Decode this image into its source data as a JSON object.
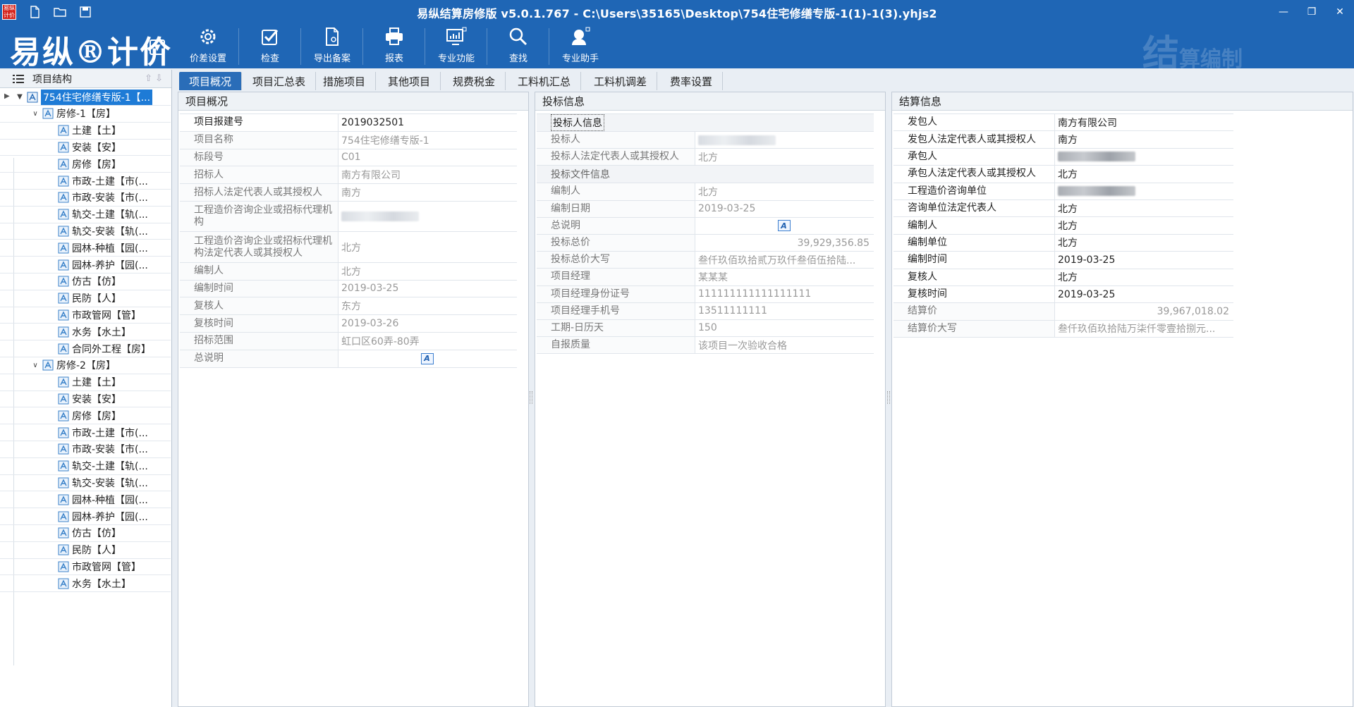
{
  "app": {
    "title": "易纵结算房修版 v5.0.1.767 - C:\\Users\\35165\\Desktop\\754住宅修缮专版-1(1)-1(3).yhjs2",
    "badge": "易纵计价",
    "logo": "易纵®计价",
    "watermark_big": "结",
    "watermark_small": "算编制"
  },
  "toolbar": [
    {
      "label": "价差设置",
      "icon": "gear-icon"
    },
    {
      "label": "检查",
      "icon": "checkbox-icon"
    },
    {
      "label": "导出备案",
      "icon": "export-file-icon"
    },
    {
      "label": "报表",
      "icon": "printer-icon"
    },
    {
      "label": "专业功能",
      "icon": "monitor-chart-icon"
    },
    {
      "label": "查找",
      "icon": "search-icon"
    },
    {
      "label": "专业助手",
      "icon": "assistant-icon"
    }
  ],
  "tree": {
    "header": "项目结构",
    "root": "754住宅修缮专版-1【...",
    "groups": [
      {
        "label": "房修-1【房】",
        "items": [
          "土建【土】",
          "安装【安】",
          "房修【房】",
          "市政-土建【市(...",
          "市政-安装【市(...",
          "轨交-土建【轨(...",
          "轨交-安装【轨(...",
          "园林-种植【园(...",
          "园林-养护【园(...",
          "仿古【仿】",
          "民防【人】",
          "市政管网【管】",
          "水务【水土】",
          "合同外工程【房】"
        ]
      },
      {
        "label": "房修-2【房】",
        "items": [
          "土建【土】",
          "安装【安】",
          "房修【房】",
          "市政-土建【市(...",
          "市政-安装【市(...",
          "轨交-土建【轨(...",
          "轨交-安装【轨(...",
          "园林-种植【园(...",
          "园林-养护【园(...",
          "仿古【仿】",
          "民防【人】",
          "市政管网【管】",
          "水务【水土】"
        ]
      }
    ]
  },
  "tabs": [
    "项目概况",
    "项目汇总表",
    "措施项目",
    "其他项目",
    "规费税金",
    "工料机汇总",
    "工料机调差",
    "费率设置"
  ],
  "overview": {
    "title": "项目概况",
    "rows": [
      {
        "k": "项目报建号",
        "v": "2019032501",
        "bold": true
      },
      {
        "k": "项目名称",
        "v": "754住宅修缮专版-1"
      },
      {
        "k": "标段号",
        "v": "C01"
      },
      {
        "k": "招标人",
        "v": "南方有限公司"
      },
      {
        "k": "招标人法定代表人或其授权人",
        "v": "南方"
      },
      {
        "k": "工程造价咨询企业或招标代理机构",
        "v": "",
        "blur": true
      },
      {
        "k": "工程造价咨询企业或招标代理机构法定代表人或其授权人",
        "v": "北方"
      },
      {
        "k": "编制人",
        "v": "北方"
      },
      {
        "k": "编制时间",
        "v": "2019-03-25"
      },
      {
        "k": "复核人",
        "v": "东方"
      },
      {
        "k": "复核时间",
        "v": "2019-03-26"
      },
      {
        "k": "招标范围",
        "v": "虹口区60弄-80弄"
      },
      {
        "k": "总说明",
        "v": "A",
        "icon": true
      }
    ]
  },
  "bid": {
    "title": "投标信息",
    "group1": "投标人信息",
    "rows1": [
      {
        "k": "投标人",
        "v": "",
        "blur": true
      },
      {
        "k": "投标人法定代表人或其授权人",
        "v": "北方"
      }
    ],
    "group2": "投标文件信息",
    "rows2": [
      {
        "k": "编制人",
        "v": "北方"
      },
      {
        "k": "编制日期",
        "v": "2019-03-25"
      },
      {
        "k": "总说明",
        "v": "A",
        "icon": true
      },
      {
        "k": "投标总价",
        "v": "39,929,356.85",
        "right": true
      },
      {
        "k": "投标总价大写",
        "v": "叁仟玖佰玖拾贰万玖仟叁佰伍拾陆..."
      },
      {
        "k": "项目经理",
        "v": "某某某"
      },
      {
        "k": "项目经理身份证号",
        "v": "111111111111111111"
      },
      {
        "k": "项目经理手机号",
        "v": "13511111111"
      },
      {
        "k": "工期-日历天",
        "v": "150"
      },
      {
        "k": "自报质量",
        "v": "该项目一次验收合格"
      }
    ]
  },
  "settle": {
    "title": "结算信息",
    "rows": [
      {
        "k": "发包人",
        "v": "南方有限公司",
        "bold": true
      },
      {
        "k": "发包人法定代表人或其授权人",
        "v": "南方",
        "bold": true
      },
      {
        "k": "承包人",
        "v": "",
        "blur": true,
        "bold": true
      },
      {
        "k": "承包人法定代表人或其授权人",
        "v": "北方",
        "bold": true
      },
      {
        "k": "工程造价咨询单位",
        "v": "",
        "blur": true,
        "bold": true
      },
      {
        "k": "咨询单位法定代表人",
        "v": "北方",
        "bold": true
      },
      {
        "k": "编制人",
        "v": "北方",
        "bold": true
      },
      {
        "k": "编制单位",
        "v": "北方",
        "bold": true
      },
      {
        "k": "编制时间",
        "v": "2019-03-25",
        "bold": true
      },
      {
        "k": "复核人",
        "v": "北方",
        "bold": true
      },
      {
        "k": "复核时间",
        "v": "2019-03-25",
        "bold": true
      },
      {
        "k": "结算价",
        "v": "39,967,018.02",
        "right": true
      },
      {
        "k": "结算价大写",
        "v": "叁仟玖佰玖拾陆万柒仟零壹拾捌元..."
      }
    ]
  }
}
